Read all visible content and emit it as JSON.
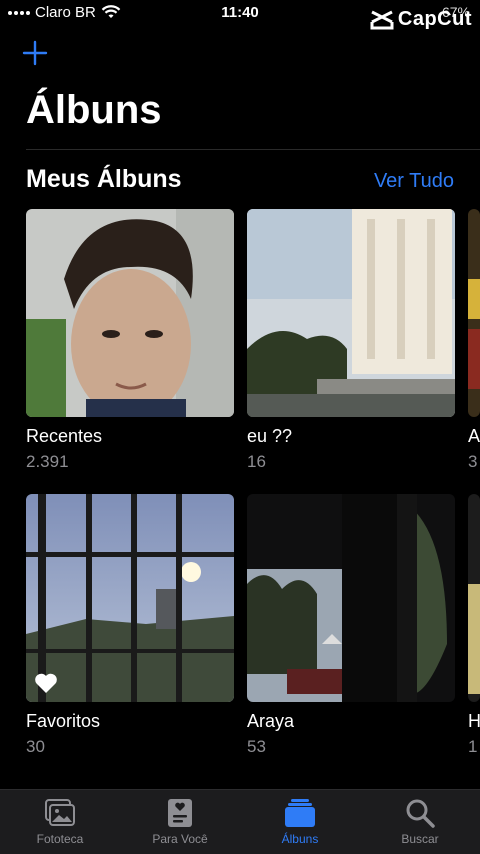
{
  "status": {
    "carrier": "Claro BR",
    "time": "11:40",
    "battery": "67%"
  },
  "watermark": {
    "text": "CapCut"
  },
  "header": {
    "title": "Álbuns"
  },
  "section": {
    "title": "Meus Álbuns",
    "see_all": "Ver Tudo"
  },
  "albums": [
    {
      "name": "Recentes",
      "count": "2.391"
    },
    {
      "name": "eu ??",
      "count": "16"
    },
    {
      "name": "A",
      "count": "3"
    },
    {
      "name": "Favoritos",
      "count": "30"
    },
    {
      "name": "Araya",
      "count": "53"
    },
    {
      "name": "H",
      "count": "1"
    }
  ],
  "tabs": [
    {
      "label": "Fototeca",
      "icon": "photo-library-icon"
    },
    {
      "label": "Para Você",
      "icon": "for-you-icon"
    },
    {
      "label": "Álbuns",
      "icon": "albums-icon",
      "active": true
    },
    {
      "label": "Buscar",
      "icon": "search-icon"
    }
  ],
  "colors": {
    "accent": "#2f7cf6",
    "secondary_text": "#8e8e93",
    "tab_bar": "#1c1c1e"
  }
}
